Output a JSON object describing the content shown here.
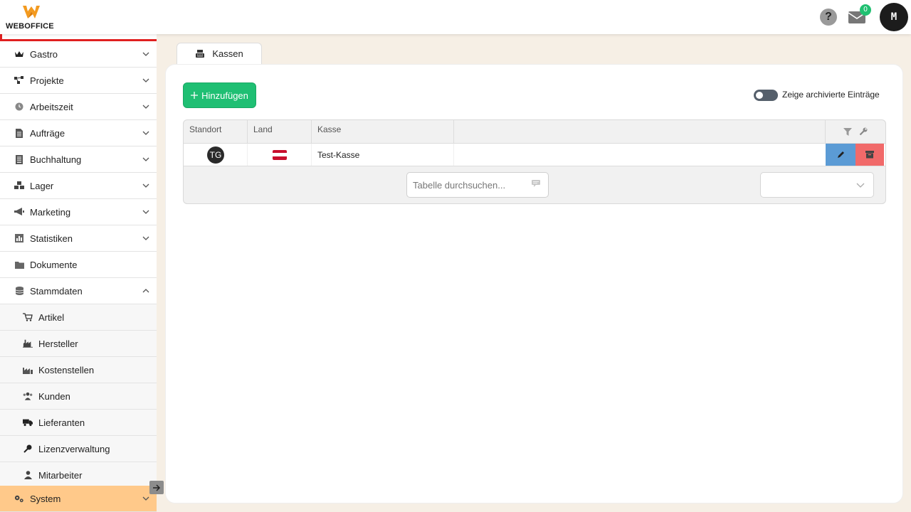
{
  "app": {
    "logo_text": "WEBOFFICE",
    "help_label": "?",
    "mail_count": "0",
    "user_initial": "M"
  },
  "sidebar": {
    "items": [
      {
        "label": "Gastro",
        "icon": "crown-icon"
      },
      {
        "label": "Projekte",
        "icon": "nodes-icon"
      },
      {
        "label": "Arbeitszeit",
        "icon": "clock-icon"
      },
      {
        "label": "Aufträge",
        "icon": "document-icon"
      },
      {
        "label": "Buchhaltung",
        "icon": "ledger-icon"
      },
      {
        "label": "Lager",
        "icon": "boxes-icon"
      },
      {
        "label": "Marketing",
        "icon": "megaphone-icon"
      },
      {
        "label": "Statistiken",
        "icon": "bar-chart-icon"
      },
      {
        "label": "Dokumente",
        "icon": "folder-icon"
      },
      {
        "label": "Stammdaten",
        "icon": "database-icon"
      }
    ],
    "sub_items": [
      {
        "label": "Artikel",
        "icon": "cart-icon"
      },
      {
        "label": "Hersteller",
        "icon": "factory-icon"
      },
      {
        "label": "Kostenstellen",
        "icon": "industry-icon"
      },
      {
        "label": "Kunden",
        "icon": "users-icon"
      },
      {
        "label": "Lieferanten",
        "icon": "truck-icon"
      },
      {
        "label": "Lizenzverwaltung",
        "icon": "key-icon"
      },
      {
        "label": "Mitarbeiter",
        "icon": "user-icon"
      }
    ],
    "system": {
      "label": "System",
      "icon": "cogs-icon"
    }
  },
  "tab": {
    "label": "Kassen",
    "icon": "cash-register-icon"
  },
  "toolbar": {
    "add_label": "Hinzufügen",
    "archive_toggle_label": "Zeige archivierte Einträge",
    "archive_toggle_on": false
  },
  "table": {
    "columns": [
      "Standort",
      "Land",
      "Kasse",
      ""
    ],
    "rows": [
      {
        "standort": "TG",
        "land": "AT",
        "kasse": "Test-Kasse"
      }
    ]
  },
  "footer": {
    "search_placeholder": "Tabelle durchsuchen...",
    "page_size_value": ""
  },
  "colors": {
    "accent_green": "#1fbf73",
    "active_nav": "#ffc98a",
    "edit_blue": "#5b9bd5",
    "delete_red": "#f16a6a",
    "brand_orange": "#f39a1f"
  }
}
